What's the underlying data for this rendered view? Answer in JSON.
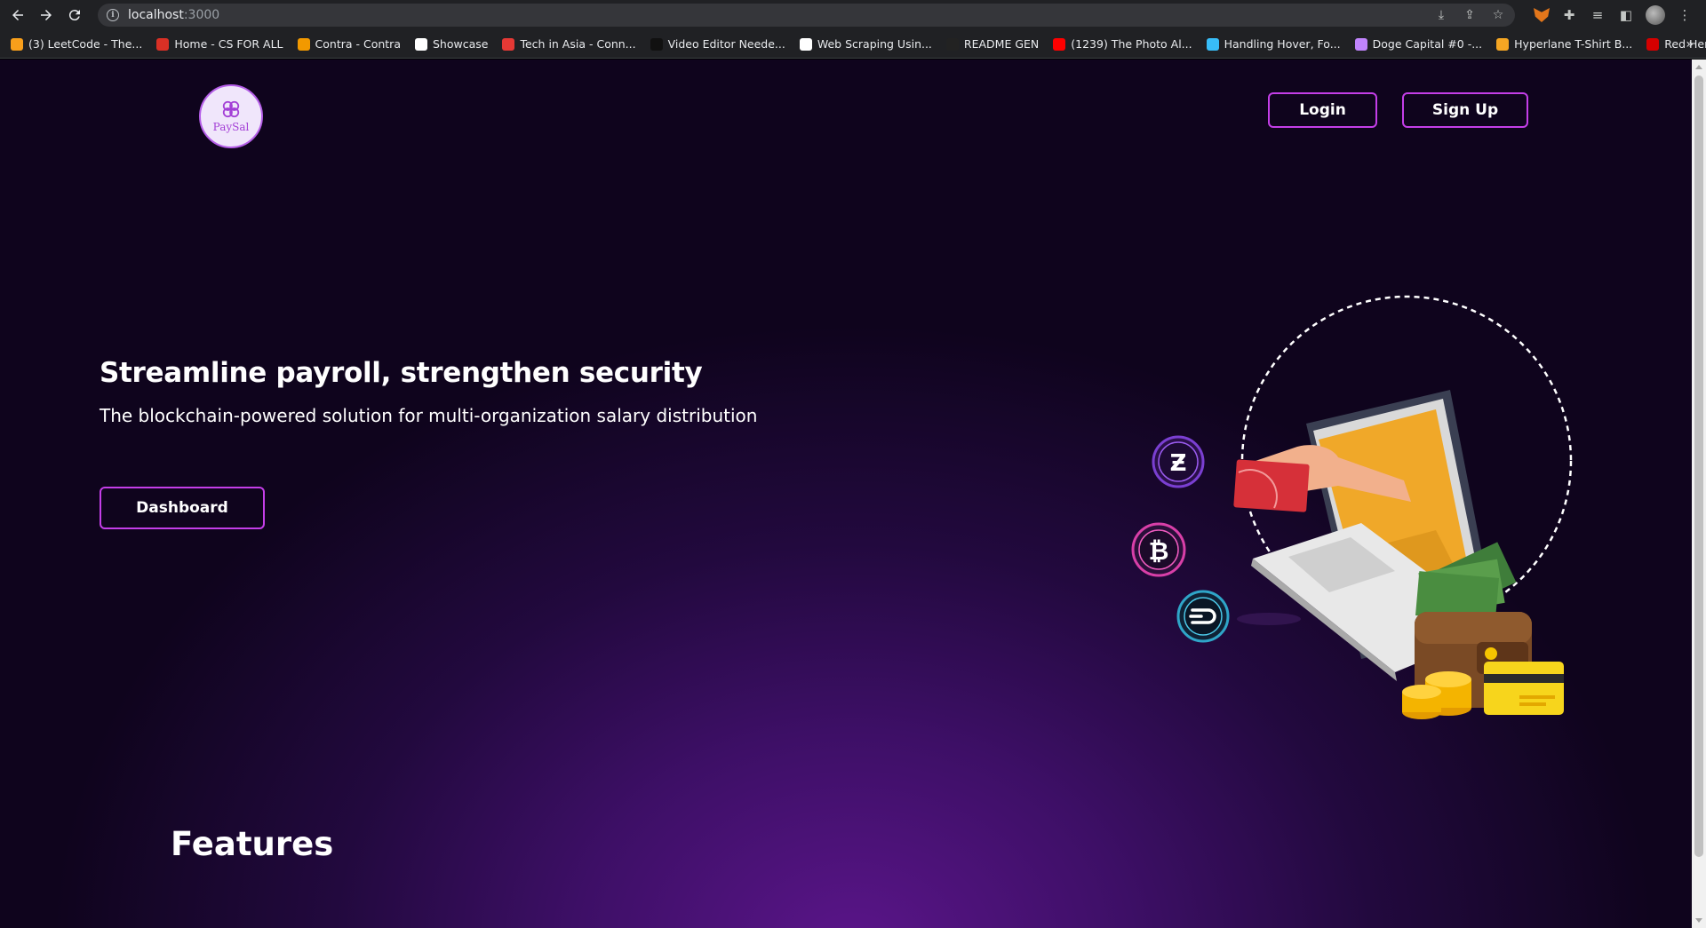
{
  "browser": {
    "url_host": "localhost",
    "url_port": ":3000",
    "bookmarks": [
      {
        "label": "(3) LeetCode - The...",
        "color": "#f89f1b"
      },
      {
        "label": "Home - CS FOR ALL",
        "color": "#d93025"
      },
      {
        "label": "Contra - Contra",
        "color": "#f29900"
      },
      {
        "label": "Showcase",
        "color": "#ffffff"
      },
      {
        "label": "Tech in Asia - Conn...",
        "color": "#e53935"
      },
      {
        "label": "Video Editor Neede...",
        "color": "#111111"
      },
      {
        "label": "Web Scraping Usin...",
        "color": "#ffffff"
      },
      {
        "label": "README GEN",
        "color": "#222222"
      },
      {
        "label": "(1239) The Photo Al...",
        "color": "#ff0000"
      },
      {
        "label": "Handling Hover, Fo...",
        "color": "#38bdf8"
      },
      {
        "label": "Doge Capital #0 -...",
        "color": "#c084fc"
      },
      {
        "label": "Hyperlane T-Shirt B...",
        "color": "#f5a623"
      },
      {
        "label": "Red Hen Lab - Red...",
        "color": "#d50000"
      }
    ],
    "more_label": "»"
  },
  "header": {
    "logo_text": "PaySal",
    "login_label": "Login",
    "signup_label": "Sign Up"
  },
  "hero": {
    "title": "Streamline payroll, strengthen security",
    "subtitle": "The blockchain-powered solution for multi-organization salary distribution",
    "cta_label": "Dashboard"
  },
  "features": {
    "title": "Features"
  },
  "colors": {
    "accent": "#c43ee8",
    "background_dark": "#0f041d",
    "background_glow": "#5a1589"
  }
}
